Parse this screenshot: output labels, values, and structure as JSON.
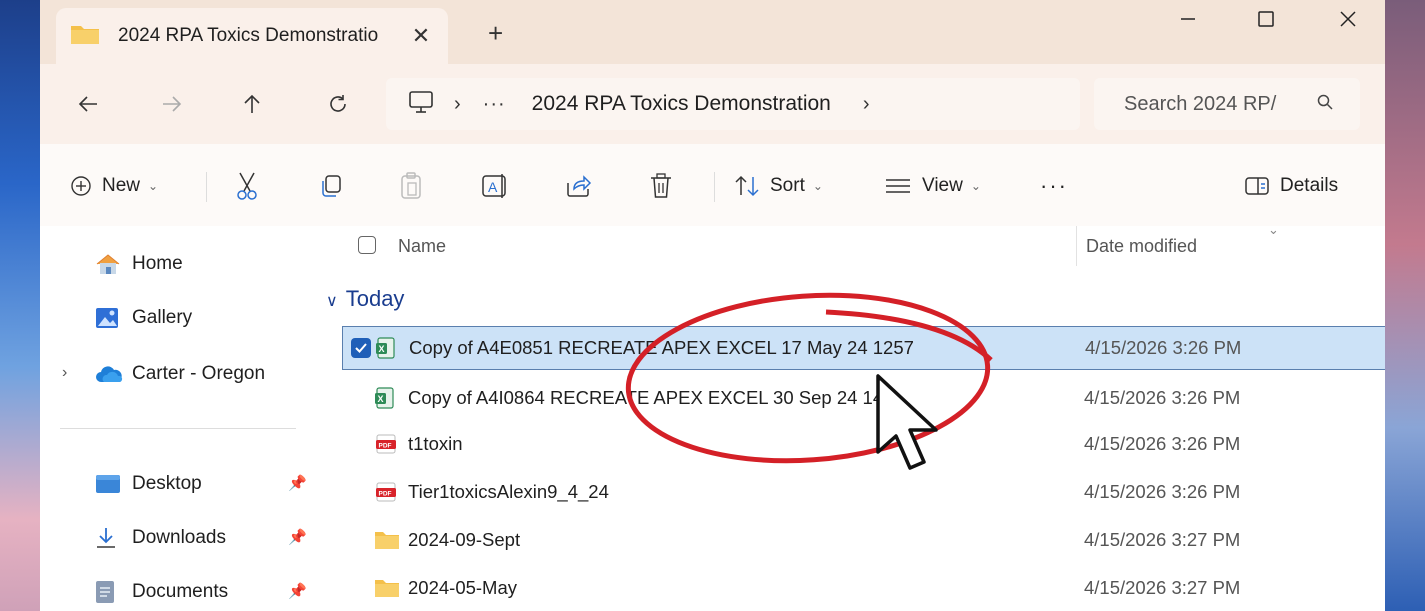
{
  "window": {
    "tab_title": "2024 RPA Toxics Demonstratio",
    "tab_close": "✕",
    "new_tab": "+"
  },
  "address": {
    "ellipsis": "···",
    "crumb": "2024 RPA Toxics Demonstration",
    "separator": "›",
    "search_placeholder": "Search 2024 RP/"
  },
  "commands": {
    "new": "New",
    "sort": "Sort",
    "view": "View",
    "more": "···",
    "details": "Details"
  },
  "sidebar": {
    "home": "Home",
    "gallery": "Gallery",
    "onedrive": "Carter - Oregon",
    "desktop": "Desktop",
    "downloads": "Downloads",
    "documents": "Documents"
  },
  "columns": {
    "name": "Name",
    "date": "Date modified"
  },
  "group": {
    "label": "Today"
  },
  "files": [
    {
      "name": "Copy of A4E0851 RECREATE APEX EXCEL 17 May 24 1257",
      "date": "4/15/2026 3:26 PM",
      "type": "excel",
      "selected": true
    },
    {
      "name": "Copy of A4I0864 RECREATE APEX EXCEL 30 Sep 24 14",
      "date": "4/15/2026 3:26 PM",
      "type": "excel",
      "selected": false
    },
    {
      "name": "t1toxin",
      "date": "4/15/2026 3:26 PM",
      "type": "pdf",
      "selected": false
    },
    {
      "name": "Tier1toxicsAlexin9_4_24",
      "date": "4/15/2026 3:26 PM",
      "type": "pdf",
      "selected": false
    },
    {
      "name": "2024-09-Sept",
      "date": "4/15/2026 3:27 PM",
      "type": "folder",
      "selected": false
    },
    {
      "name": "2024-05-May",
      "date": "4/15/2026 3:27 PM",
      "type": "folder",
      "selected": false
    }
  ],
  "colors": {
    "accent": "#1f5fb8",
    "selection": "#cce2f7",
    "annotation": "#d42027",
    "folder": "#f4c04a",
    "excel": "#2e8b57",
    "pdf": "#d8232a"
  }
}
